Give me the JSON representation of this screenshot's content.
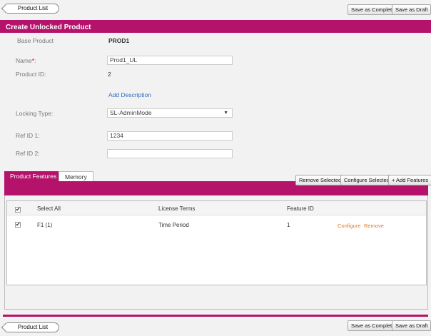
{
  "top_bar": {
    "product_list": "Product List",
    "save_complete": "Save as Complete",
    "save_draft": "Save as Draft"
  },
  "header": {
    "title": "Create Unlocked Product"
  },
  "form": {
    "base_product_label": "Base Product",
    "base_product_value": "PROD1",
    "name_label": "Name",
    "name_required": "*",
    "name_colon": ":",
    "name_value": "Prod1_UL",
    "product_id_label": "Product ID:",
    "product_id_value": "2",
    "add_description": "Add Description",
    "locking_type_label": "Locking Type:",
    "locking_type_value": "SL-AdminMode",
    "ref_id1_label": "Ref ID 1:",
    "ref_id1_value": "1234",
    "ref_id2_label": "Ref ID 2:",
    "ref_id2_value": ""
  },
  "tabs": [
    {
      "label": "Product Features",
      "active": true
    },
    {
      "label": "Memory",
      "active": false
    }
  ],
  "toolbar": {
    "remove_selected": "Remove Selected",
    "configure_selected": "Configure Selected",
    "add_features": "+ Add Features"
  },
  "grid": {
    "headers": {
      "select_all": "Select All",
      "license_terms": "License Terms",
      "feature_id": "Feature ID"
    },
    "rows": [
      {
        "name": "F1 (1)",
        "license_terms": "Time Period",
        "feature_id": "1",
        "configure": "Configure",
        "remove": "Remove",
        "checked": true
      }
    ]
  },
  "bottom_bar": {
    "product_list": "Product List",
    "save_complete": "Save as Complete",
    "save_draft": "Save as Draft"
  },
  "colors": {
    "accent": "#b5126b",
    "link": "#2b6cc4",
    "action": "#e07b28"
  },
  "icons": {
    "select_arrow": "▼",
    "check": "✔"
  }
}
